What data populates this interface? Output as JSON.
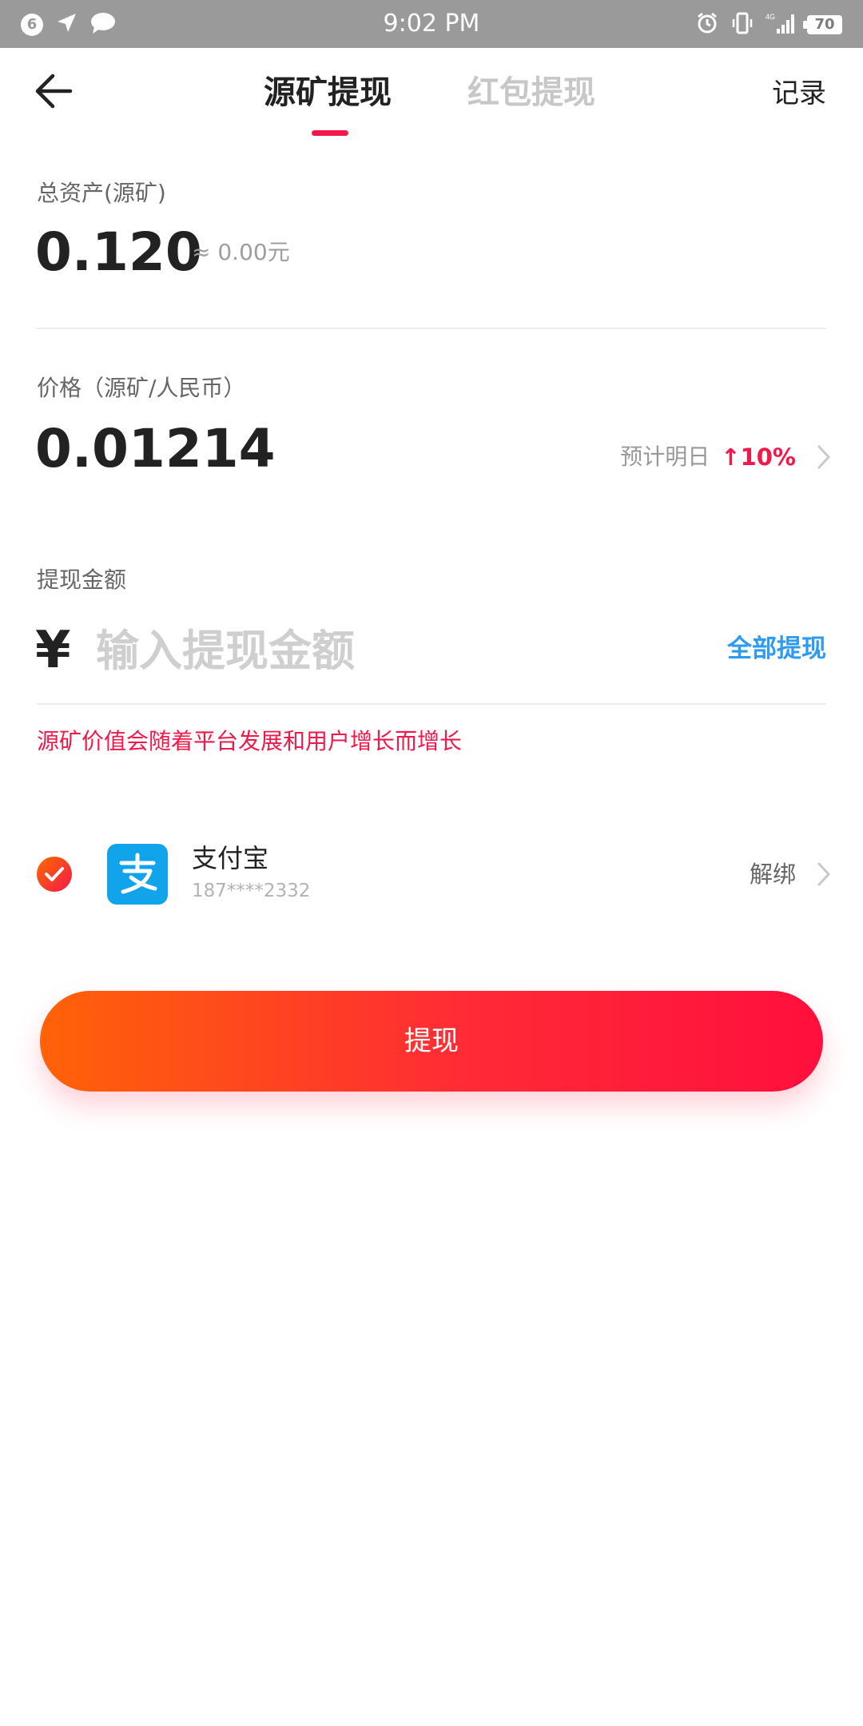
{
  "status_bar": {
    "time": "9:02 PM",
    "notification_count": "6",
    "battery": "70",
    "network": "4G"
  },
  "header": {
    "tabs": [
      {
        "label": "源矿提现",
        "active": true
      },
      {
        "label": "红包提现",
        "active": false
      }
    ],
    "records_label": "记录"
  },
  "assets": {
    "label": "总资产(源矿)",
    "value": "0.120",
    "approx_cny": "≈ 0.00元"
  },
  "price": {
    "label": "价格（源矿/人民币）",
    "value": "0.01214",
    "forecast_label": "预计明日",
    "forecast_change": "↑10%"
  },
  "withdraw": {
    "label": "提现金额",
    "currency_symbol": "¥",
    "placeholder": "输入提现金额",
    "withdraw_all_label": "全部提现",
    "notice": "源矿价值会随着平台发展和用户增长而增长"
  },
  "payment": {
    "name": "支付宝",
    "account": "187****2332",
    "unbind_label": "解绑"
  },
  "submit": {
    "label": "提现"
  },
  "colors": {
    "accent_red": "#f2184a",
    "link_blue": "#2e9bf0",
    "alipay_blue": "#11a4ea",
    "gradient_start": "#ff6208",
    "gradient_end": "#ff0f3d"
  }
}
